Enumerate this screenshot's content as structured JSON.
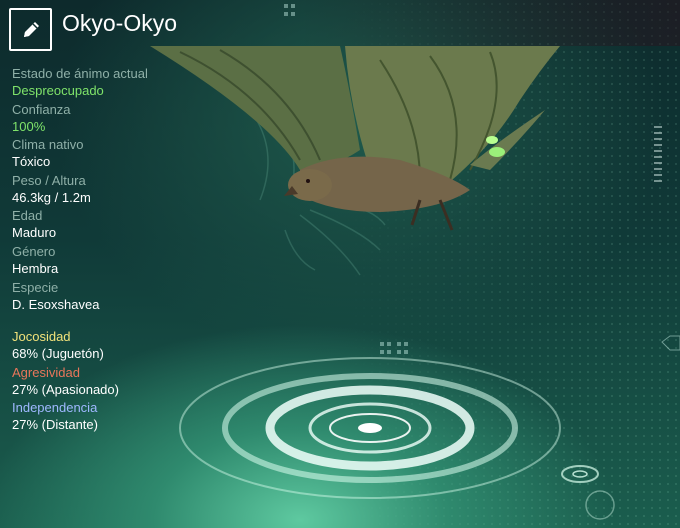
{
  "header": {
    "title": "Okyo-Okyo",
    "edit_icon": "pencil-icon"
  },
  "stats": [
    {
      "label": "Estado de ánimo actual",
      "value": "Despreocupado",
      "highlight": true
    },
    {
      "label": "Confianza",
      "value": "100%",
      "highlight": true
    },
    {
      "label": "Clima nativo",
      "value": "Tóxico",
      "highlight": false
    },
    {
      "label": "Peso / Altura",
      "value": "46.3kg / 1.2m",
      "highlight": false
    },
    {
      "label": "Edad",
      "value": "Maduro",
      "highlight": false
    },
    {
      "label": "Género",
      "value": "Hembra",
      "highlight": false
    },
    {
      "label": "Especie",
      "value": "D. Esoxshavea",
      "highlight": false
    }
  ],
  "traits": [
    {
      "label": "Jocosidad",
      "value": "68% (Juguetón)",
      "color": "#f2e27a"
    },
    {
      "label": "Agresividad",
      "value": "27% (Apasionado)",
      "color": "#e8765a"
    },
    {
      "label": "Independencia",
      "value": "27% (Distante)",
      "color": "#9fb8ff"
    }
  ],
  "colors": {
    "accent_green": "#7fe36a",
    "label_gray": "#8fb0a8"
  }
}
